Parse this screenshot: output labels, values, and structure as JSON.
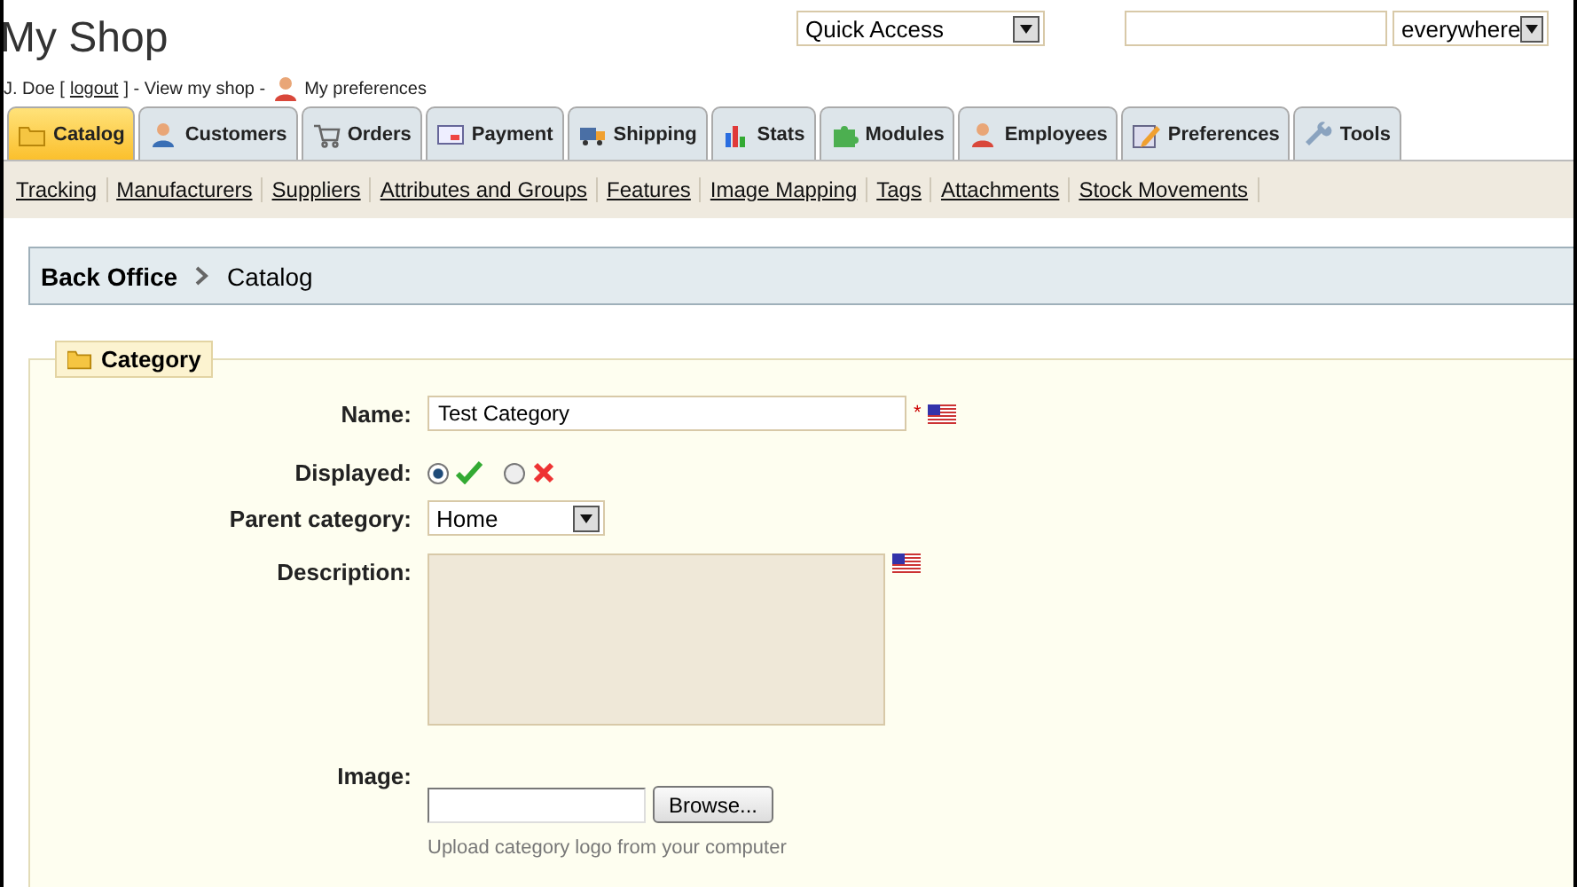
{
  "header": {
    "title": "My Shop",
    "user_name": "J. Doe [",
    "logout_link": "logout",
    "user_sep": "] - View my shop -",
    "preferences_link": "My preferences",
    "quick_access": "Quick Access",
    "search_scope": "everywhere"
  },
  "tabs": [
    {
      "label": "Catalog",
      "selected": true
    },
    {
      "label": "Customers",
      "selected": false
    },
    {
      "label": "Orders",
      "selected": false
    },
    {
      "label": "Payment",
      "selected": false
    },
    {
      "label": "Shipping",
      "selected": false
    },
    {
      "label": "Stats",
      "selected": false
    },
    {
      "label": "Modules",
      "selected": false
    },
    {
      "label": "Employees",
      "selected": false
    },
    {
      "label": "Preferences",
      "selected": false
    },
    {
      "label": "Tools",
      "selected": false
    }
  ],
  "subtabs": [
    "Tracking",
    "Manufacturers",
    "Suppliers",
    "Attributes and Groups",
    "Features",
    "Image Mapping",
    "Tags",
    "Attachments",
    "Stock Movements"
  ],
  "breadcrumb": [
    "Back Office",
    "Catalog"
  ],
  "form": {
    "legend": "Category",
    "fields": [
      {
        "kind": "text",
        "label": "Name:",
        "value": "Test Category",
        "required_mark": "*"
      },
      {
        "kind": "radio",
        "label": "Displayed:",
        "options": [
          {
            "selected": true
          },
          {
            "selected": false
          }
        ]
      },
      {
        "kind": "select",
        "label": "Parent category:",
        "value": "Home"
      },
      {
        "kind": "textarea",
        "label": "Description:"
      },
      {
        "kind": "file",
        "label": "Image:",
        "button": "Browse...",
        "hint": "Upload category logo from your computer"
      }
    ]
  }
}
